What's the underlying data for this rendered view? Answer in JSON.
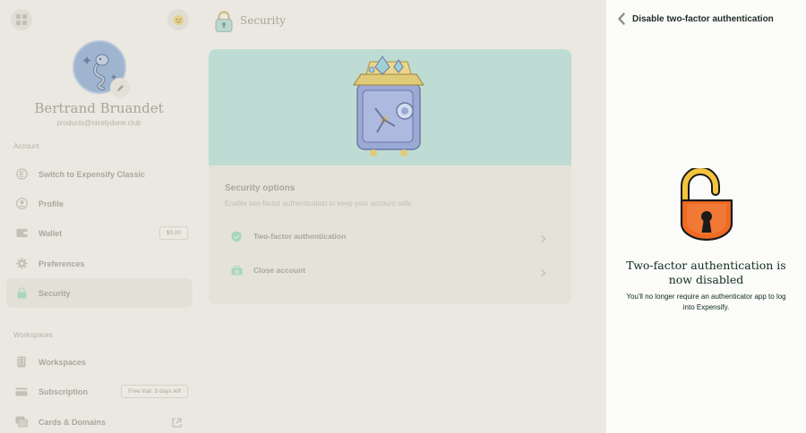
{
  "sidebar": {
    "user": {
      "name": "Bertrand Bruandet",
      "email": "products@nicelydone.club"
    },
    "account_label": "Account",
    "workspaces_label": "Workspaces",
    "items": [
      {
        "label": "Switch to Expensify Classic",
        "icon": "expensify-icon"
      },
      {
        "label": "Profile",
        "icon": "profile-icon"
      },
      {
        "label": "Wallet",
        "icon": "wallet-icon",
        "badge": "$0.00"
      },
      {
        "label": "Preferences",
        "icon": "gear-icon"
      },
      {
        "label": "Security",
        "icon": "lock-icon",
        "active": true
      },
      {
        "label": "Workspaces",
        "icon": "building-icon"
      },
      {
        "label": "Subscription",
        "icon": "card-icon",
        "badge": "Free trial: 3 days left"
      },
      {
        "label": "Cards & Domains",
        "icon": "cards-icon"
      }
    ]
  },
  "main": {
    "title": "Security",
    "options_title": "Security options",
    "options_subtitle": "Enable two-factor authentication to keep your account safe.",
    "options": [
      {
        "label": "Two-factor authentication",
        "icon": "shield-icon"
      },
      {
        "label": "Close account",
        "icon": "close-account-icon"
      }
    ]
  },
  "rhp": {
    "title": "Disable two-factor authentication",
    "heading": "Two-factor authentication is now disabled",
    "subtitle": "You'll no longer require an authenticator app to log into Expensify."
  },
  "colors": {
    "app_bg": "#ebe8e1",
    "hero_bg": "#bedcd3",
    "panel_bg": "#fbfbf9",
    "heading_text": "#0e2a1f",
    "lock_orange": "#f06a22",
    "lock_shackle": "#f4c53b"
  }
}
